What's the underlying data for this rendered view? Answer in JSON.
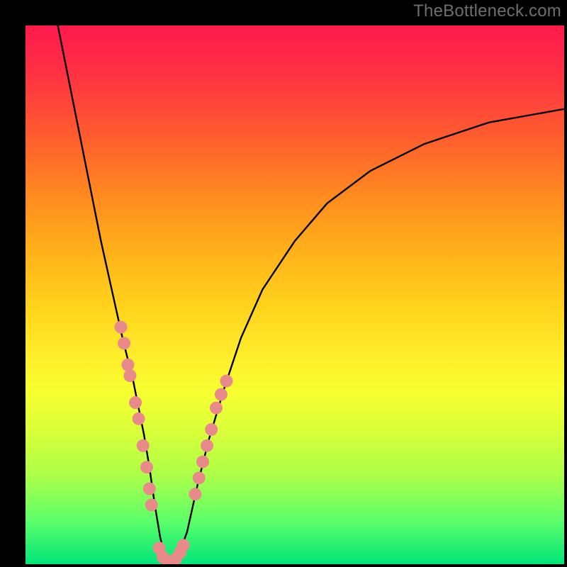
{
  "watermark": "TheBottleneck.com",
  "chart_data": {
    "type": "line",
    "title": "",
    "xlabel": "",
    "ylabel": "",
    "xlim": [
      0,
      100
    ],
    "ylim": [
      0,
      100
    ],
    "curve": {
      "x": [
        6,
        8,
        10,
        12,
        14,
        16,
        18,
        20,
        22,
        23,
        24,
        25,
        26,
        27,
        28,
        30,
        32,
        34,
        37,
        40,
        44,
        50,
        56,
        64,
        74,
        86,
        100
      ],
      "y": [
        100,
        90,
        80,
        70,
        60,
        51,
        42,
        34,
        24,
        18,
        11,
        5,
        1,
        0,
        0.5,
        6,
        15,
        23,
        33,
        42,
        51,
        60,
        67,
        73,
        78,
        82,
        84.5
      ]
    },
    "green_band_y": [
      0,
      6
    ],
    "marker_clusters": [
      {
        "name": "left-descent",
        "points_xy": [
          [
            17.7,
            44
          ],
          [
            18.3,
            41
          ],
          [
            19,
            37
          ],
          [
            19.4,
            35
          ],
          [
            20.4,
            30
          ],
          [
            21,
            27
          ],
          [
            21.8,
            22
          ],
          [
            22.5,
            18
          ],
          [
            23,
            14
          ],
          [
            23.4,
            11
          ]
        ]
      },
      {
        "name": "valley-floor",
        "points_xy": [
          [
            24.8,
            3
          ],
          [
            25.5,
            1.3
          ],
          [
            26.3,
            0.6
          ],
          [
            27.1,
            0.5
          ],
          [
            27.9,
            1
          ],
          [
            28.7,
            2.2
          ],
          [
            29.3,
            3.5
          ]
        ]
      },
      {
        "name": "right-ascent",
        "points_xy": [
          [
            31.5,
            13
          ],
          [
            32.2,
            16
          ],
          [
            32.9,
            19
          ],
          [
            33.7,
            22
          ],
          [
            34.5,
            25
          ],
          [
            35.4,
            29
          ],
          [
            36.3,
            31.5
          ],
          [
            37.3,
            34
          ]
        ]
      }
    ],
    "marker_color": "#e98a8a",
    "curve_color": "#000000"
  }
}
